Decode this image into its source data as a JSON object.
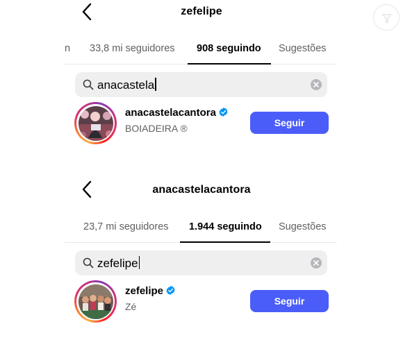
{
  "top": {
    "title": "zefelipe",
    "tabs": [
      {
        "label": "n",
        "active": false
      },
      {
        "label": "33,8 mi seguidores",
        "active": false
      },
      {
        "label": "908 seguindo",
        "active": true
      },
      {
        "label": "Sugestões",
        "active": false
      }
    ],
    "search": {
      "value": "anacastela",
      "placeholder": ""
    },
    "result": {
      "username": "anacastelacantora",
      "verified": true,
      "subtitle": "BOIADEIRA ®",
      "follow_label": "Seguir",
      "story_ring": true
    }
  },
  "bottom": {
    "title": "anacastelacantora",
    "tabs": [
      {
        "label": "23,7 mi seguidores",
        "active": false
      },
      {
        "label": "1.944 seguindo",
        "active": true
      },
      {
        "label": "Sugestões",
        "active": false
      }
    ],
    "search": {
      "value": "zefelipe",
      "placeholder": ""
    },
    "result": {
      "username": "zefelipe",
      "verified": true,
      "subtitle": "Zé",
      "follow_label": "Seguir",
      "story_ring": true
    }
  },
  "icons": {
    "back": "chevron-left-icon",
    "search": "search-icon",
    "clear": "clear-icon",
    "verified": "verified-badge-icon",
    "watermark": "watermark-logo"
  },
  "colors": {
    "follow_button": "#4a5df9",
    "verified_badge": "#0095f6",
    "search_background": "#efeff0",
    "inactive_tab_text": "#5f5f5f",
    "subtitle_text": "#606060"
  }
}
